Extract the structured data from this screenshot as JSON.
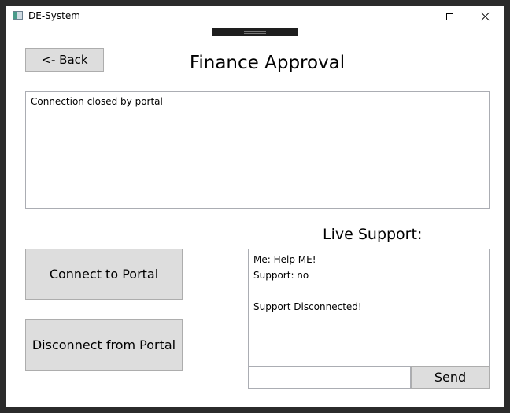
{
  "window": {
    "title": "DE-System"
  },
  "header": {
    "back_label": "<- Back",
    "title": "Finance Approval"
  },
  "log": {
    "text": "Connection closed by portal"
  },
  "actions": {
    "connect_label": "Connect to Portal",
    "disconnect_label": "Disconnect from Portal"
  },
  "support": {
    "label": "Live Support:",
    "messages": [
      "Me: Help ME!",
      "Support: no",
      "",
      "Support Disconnected!"
    ],
    "input_value": "",
    "send_label": "Send"
  }
}
